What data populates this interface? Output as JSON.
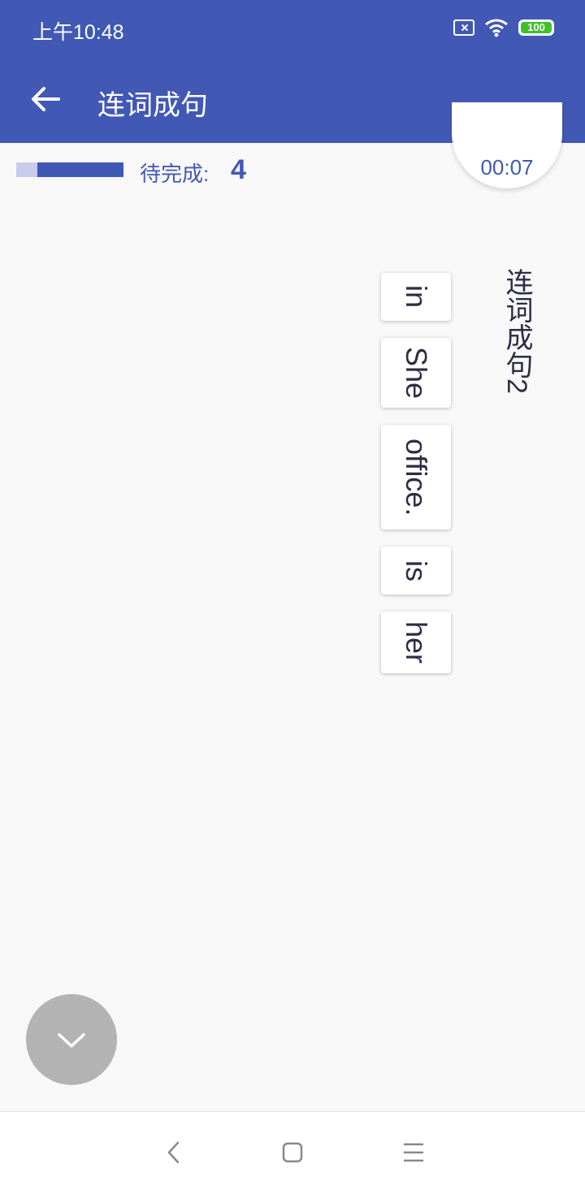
{
  "status_bar": {
    "time": "上午10:48",
    "battery": "100",
    "icons": [
      "sim-error-icon",
      "wifi-icon",
      "battery-icon"
    ]
  },
  "app_bar": {
    "title": "连词成句",
    "back_icon": "arrow-left-icon"
  },
  "progress": {
    "pending_label": "待完成:",
    "pending_count": "4",
    "completed_fraction": 0.2
  },
  "timer": {
    "text": "00:07"
  },
  "question": {
    "title": "连词成句2"
  },
  "words": [
    {
      "text": "in"
    },
    {
      "text": "She"
    },
    {
      "text": "office."
    },
    {
      "text": "is"
    },
    {
      "text": "her"
    }
  ],
  "fab": {
    "icon": "chevron-down-icon"
  },
  "nav_bar": {
    "icons": [
      "nav-back-icon",
      "nav-home-icon",
      "nav-menu-icon"
    ]
  },
  "colors": {
    "primary": "#4159b5",
    "progress_done": "#c7cce8",
    "fab": "#b3b3b3",
    "text": "#2d2d45",
    "battery": "#40c02a"
  }
}
